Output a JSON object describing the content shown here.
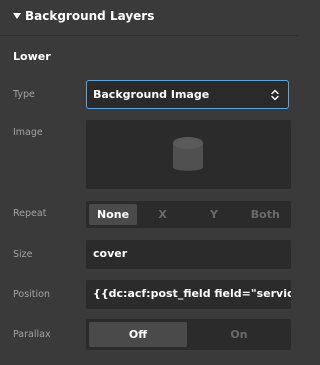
{
  "panel": {
    "section_title": "Background Layers",
    "group_title": "Lower"
  },
  "type_row": {
    "label": "Type",
    "selected": "Background Image",
    "accent_color": "#5fa4dd"
  },
  "image_row": {
    "label": "Image",
    "placeholder_icon": "database-icon"
  },
  "repeat_row": {
    "label": "Repeat",
    "options": [
      "None",
      "X",
      "Y",
      "Both"
    ],
    "selected": "None"
  },
  "size_row": {
    "label": "Size",
    "value": "cover"
  },
  "position_row": {
    "label": "Position",
    "value": "{{dc:acf:post_field field=\"service_t"
  },
  "parallax_row": {
    "label": "Parallax",
    "options": [
      "Off",
      "On"
    ],
    "selected": "Off"
  }
}
